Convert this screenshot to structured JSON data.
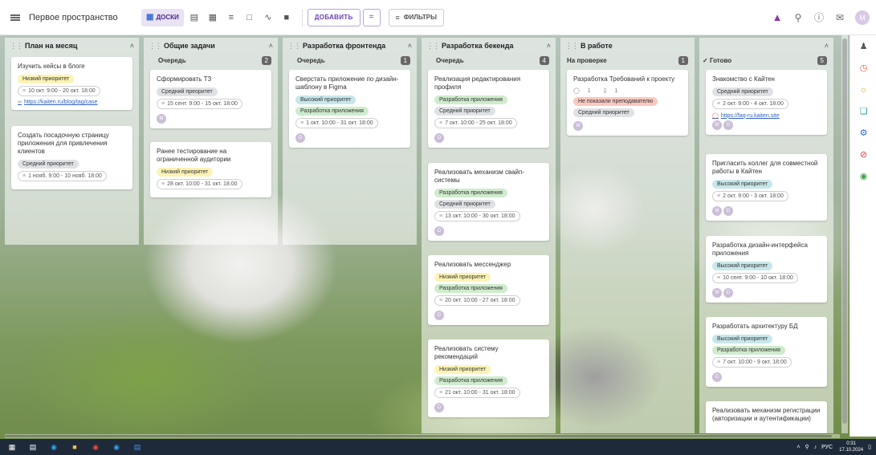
{
  "topbar": {
    "space_title": "Первое пространство",
    "views": [
      {
        "icon": "boards-icon",
        "label": "ДОСКИ",
        "active": true
      },
      {
        "icon": "list-icon",
        "label": ""
      },
      {
        "icon": "table-icon",
        "label": ""
      },
      {
        "icon": "timeline-icon",
        "label": ""
      },
      {
        "icon": "calendar-icon",
        "label": ""
      },
      {
        "icon": "chart-icon",
        "label": ""
      },
      {
        "icon": "docs-icon",
        "label": ""
      }
    ],
    "add_label": "ДОБАВИТЬ",
    "filters_label": "ФИЛЬТРЫ",
    "avatar_letter": "M"
  },
  "columns": [
    {
      "title": "План на месяц",
      "lane": "",
      "count": "",
      "cards": [
        {
          "title": "Изучить кейсы в блоге",
          "tags": [
            {
              "text": "Низкий приоритет",
              "kind": "low"
            }
          ],
          "date": "10 окт. 9:00 - 20 окт. 18:00",
          "link": "https://kaiten.ru/blog/tag/case"
        },
        {
          "title": "Создать посадочную страницу приложения для привлечения клиентов",
          "tags": [
            {
              "text": "Средний приоритет",
              "kind": "mid"
            }
          ],
          "date": "1 нояб. 9:00 - 10 нояб. 18:00"
        }
      ]
    },
    {
      "title": "Общие задачи",
      "lane": "Очередь",
      "count": "2",
      "cards": [
        {
          "title": "Сформировать ТЗ",
          "tags": [
            {
              "text": "Средний преоритет",
              "kind": "mid"
            }
          ],
          "date": "15 сент. 9:00 - 15 окт. 18:00",
          "avatars": [
            "M"
          ]
        },
        {
          "title": "Ранее тестирование на ограниченной аудитории",
          "tags": [
            {
              "text": "Низкий приоритет",
              "kind": "low"
            }
          ],
          "date": "28 окт. 10:00 - 31 окт. 18:00"
        }
      ]
    },
    {
      "title": "Разработка фронтенда",
      "lane": "Очередь",
      "count": "1",
      "cards": [
        {
          "title": "Сверстать приложение по дизайн-шаблону в Figma",
          "tags": [
            {
              "text": "Высокий приоритет",
              "kind": "high"
            },
            {
              "text": "Разработка приложения",
              "kind": "dev"
            }
          ],
          "date": "1 окт. 10:00 - 31 окт. 18:00",
          "avatars": [
            "D"
          ]
        }
      ]
    },
    {
      "title": "Разработка бекенда",
      "lane": "Очередь",
      "count": "4",
      "cards": [
        {
          "title": "Реализация редактирования профиля",
          "tags": [
            {
              "text": "Разработка приложения",
              "kind": "dev"
            },
            {
              "text": "Средний приоритет",
              "kind": "mid"
            }
          ],
          "date": "7 окт. 10:00 - 25 окт. 18:00",
          "avatars": [
            "D"
          ]
        },
        {
          "title": "Реализовать механизм свайп-системы",
          "tags": [
            {
              "text": "Разработка приложения",
              "kind": "dev"
            },
            {
              "text": "Средний приоритет",
              "kind": "mid"
            }
          ],
          "date": "13 окт. 10:00 - 30 окт. 18:00",
          "avatars": [
            "D"
          ]
        },
        {
          "title": "Реализовать мессенджер",
          "tags": [
            {
              "text": "Низкий приоритет",
              "kind": "low"
            },
            {
              "text": "Разработка приложения",
              "kind": "dev"
            }
          ],
          "date": "20 окт. 10:00 - 27 окт. 18:00",
          "avatars": [
            "D"
          ]
        },
        {
          "title": "Реализовать систему рекомендаций",
          "tags": [
            {
              "text": "Низкий приоритет",
              "kind": "low"
            },
            {
              "text": "Разработка приложения",
              "kind": "dev"
            }
          ],
          "date": "21 окт. 10:00 - 31 окт. 18:00",
          "avatars": [
            "D"
          ]
        }
      ]
    },
    {
      "title": "В работе",
      "lane": "На проверке",
      "count": "1",
      "cards": [
        {
          "title": "Разработка Требований к проекту",
          "meta": [
            "1",
            "1"
          ],
          "tags": [
            {
              "text": "Не показали преподавателю",
              "kind": "warn"
            },
            {
              "text": "Средний приоритет",
              "kind": "mid"
            }
          ],
          "avatars": [
            "M"
          ]
        }
      ]
    },
    {
      "title": "",
      "lane": "Готово",
      "count": "5",
      "cards": [
        {
          "title": "Знакомство с Кайтен",
          "tags": [
            {
              "text": "Средний приоритет",
              "kind": "mid"
            }
          ],
          "date": "2 окт. 9:00 - 4 окт. 18:00",
          "link": "https://faq-ru.kaiten.site",
          "avatars": [
            "M",
            "D"
          ]
        },
        {
          "title": "Пригласить коллег для совместной работы в Кайтен",
          "tags": [
            {
              "text": "Высокий приоритет",
              "kind": "high"
            }
          ],
          "date": "2 окт. 9:00 - 3 окт. 18:00",
          "avatars": [
            "M",
            "D"
          ]
        },
        {
          "title": "Разработка дизайн-интерфейса приложения",
          "tags": [
            {
              "text": "Высокий приоритет",
              "kind": "high"
            }
          ],
          "date": "10 сент. 9:00 - 10 окт. 18:00",
          "avatars": [
            "M",
            "D"
          ]
        },
        {
          "title": "Разработать архитектуру БД",
          "tags": [
            {
              "text": "Высокий приоритет",
              "kind": "high"
            },
            {
              "text": "Разработка приложения",
              "kind": "dev"
            }
          ],
          "date": "7 окт. 10:00 - 9 окт. 18:00",
          "avatars": [
            "D"
          ]
        },
        {
          "title": "Реализовать механизм регистрации (авторизации и аутентификации)"
        }
      ]
    }
  ],
  "sidebar_icons": [
    "users-icon",
    "timer-icon",
    "sun-icon",
    "copy-icon",
    "gear-icon",
    "block-icon",
    "settings-icon"
  ],
  "taskbar": {
    "lang": "РУС",
    "time": "0:31",
    "date": "17.10.2024"
  }
}
